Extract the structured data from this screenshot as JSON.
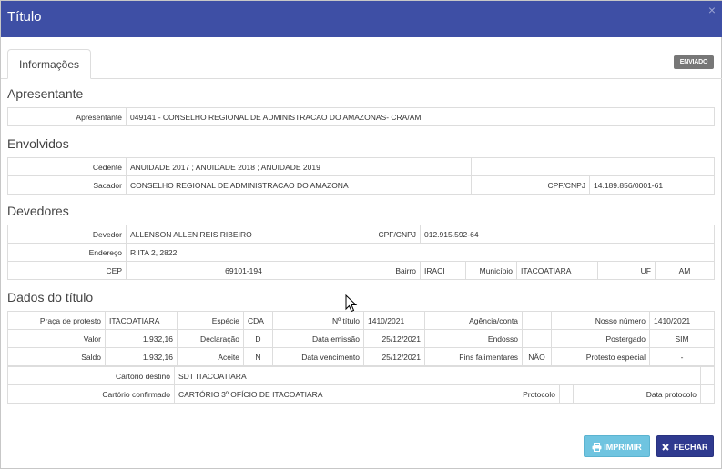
{
  "header": {
    "title": "Título",
    "close_glyph": "×"
  },
  "tabs": [
    {
      "label": "Informações"
    }
  ],
  "status_badge": "ENVIADO",
  "sections": {
    "apresentante": "Apresentante",
    "envolvidos": "Envolvidos",
    "devedores": "Devedores",
    "dados": "Dados do título"
  },
  "apresentante": {
    "label": "Apresentante",
    "value": "049141 - CONSELHO REGIONAL DE ADMINISTRACAO DO AMAZONAS- CRA/AM"
  },
  "envolvidos": {
    "cedente_label": "Cedente",
    "cedente_value": "ANUIDADE 2017 ; ANUIDADE 2018 ; ANUIDADE 2019",
    "sacador_label": "Sacador",
    "sacador_value": "CONSELHO REGIONAL DE ADMINISTRACAO DO AMAZONA",
    "cpf_label": "CPF/CNPJ",
    "cpf_value": "14.189.856/0001-61"
  },
  "devedores": {
    "devedor_label": "Devedor",
    "devedor_value": "ALLENSON ALLEN REIS RIBEIRO",
    "cpf_label": "CPF/CNPJ",
    "cpf_value": "012.915.592-64",
    "endereco_label": "Endereço",
    "endereco_value": "R ITA 2, 2822,",
    "cep_label": "CEP",
    "cep_value": "69101-194",
    "bairro_label": "Bairro",
    "bairro_value": "IRACI",
    "municipio_label": "Município",
    "municipio_value": "ITACOATIARA",
    "uf_label": "UF",
    "uf_value": "AM"
  },
  "dados": {
    "praca_label": "Praça de protesto",
    "praca_value": "ITACOATIARA",
    "especie_label": "Espécie",
    "especie_value": "CDA",
    "ntitulo_label": "Nº título",
    "ntitulo_value": "1410/2021",
    "agencia_label": "Agência/conta",
    "agencia_value": "",
    "nosso_label": "Nosso número",
    "nosso_value": "1410/2021",
    "valor_label": "Valor",
    "valor_value": "1.932,16",
    "declaracao_label": "Declaração",
    "declaracao_value": "D",
    "emissao_label": "Data emissão",
    "emissao_value": "25/12/2021",
    "endosso_label": "Endosso",
    "endosso_value": "",
    "postergado_label": "Postergado",
    "postergado_value": "SIM",
    "saldo_label": "Saldo",
    "saldo_value": "1.932,16",
    "aceite_label": "Aceite",
    "aceite_value": "N",
    "vencimento_label": "Data vencimento",
    "vencimento_value": "25/12/2021",
    "fins_label": "Fins falimentares",
    "fins_value": "NÃO",
    "especial_label": "Protesto especial",
    "especial_value": "-",
    "cart_destino_label": "Cartório destino",
    "cart_destino_value": "SDT ITACOATIARA",
    "cart_conf_label": "Cartório confirmado",
    "cart_conf_value": "CARTÓRIO 3º OFÍCIO DE ITACOATIARA",
    "protocolo_label": "Protocolo",
    "protocolo_value": "",
    "data_protocolo_label": "Data protocolo",
    "data_protocolo_value": ""
  },
  "buttons": {
    "print": "IMPRIMIR",
    "close": "FECHAR"
  },
  "icons": {
    "print": "printer-icon",
    "close": "close-x-icon"
  }
}
